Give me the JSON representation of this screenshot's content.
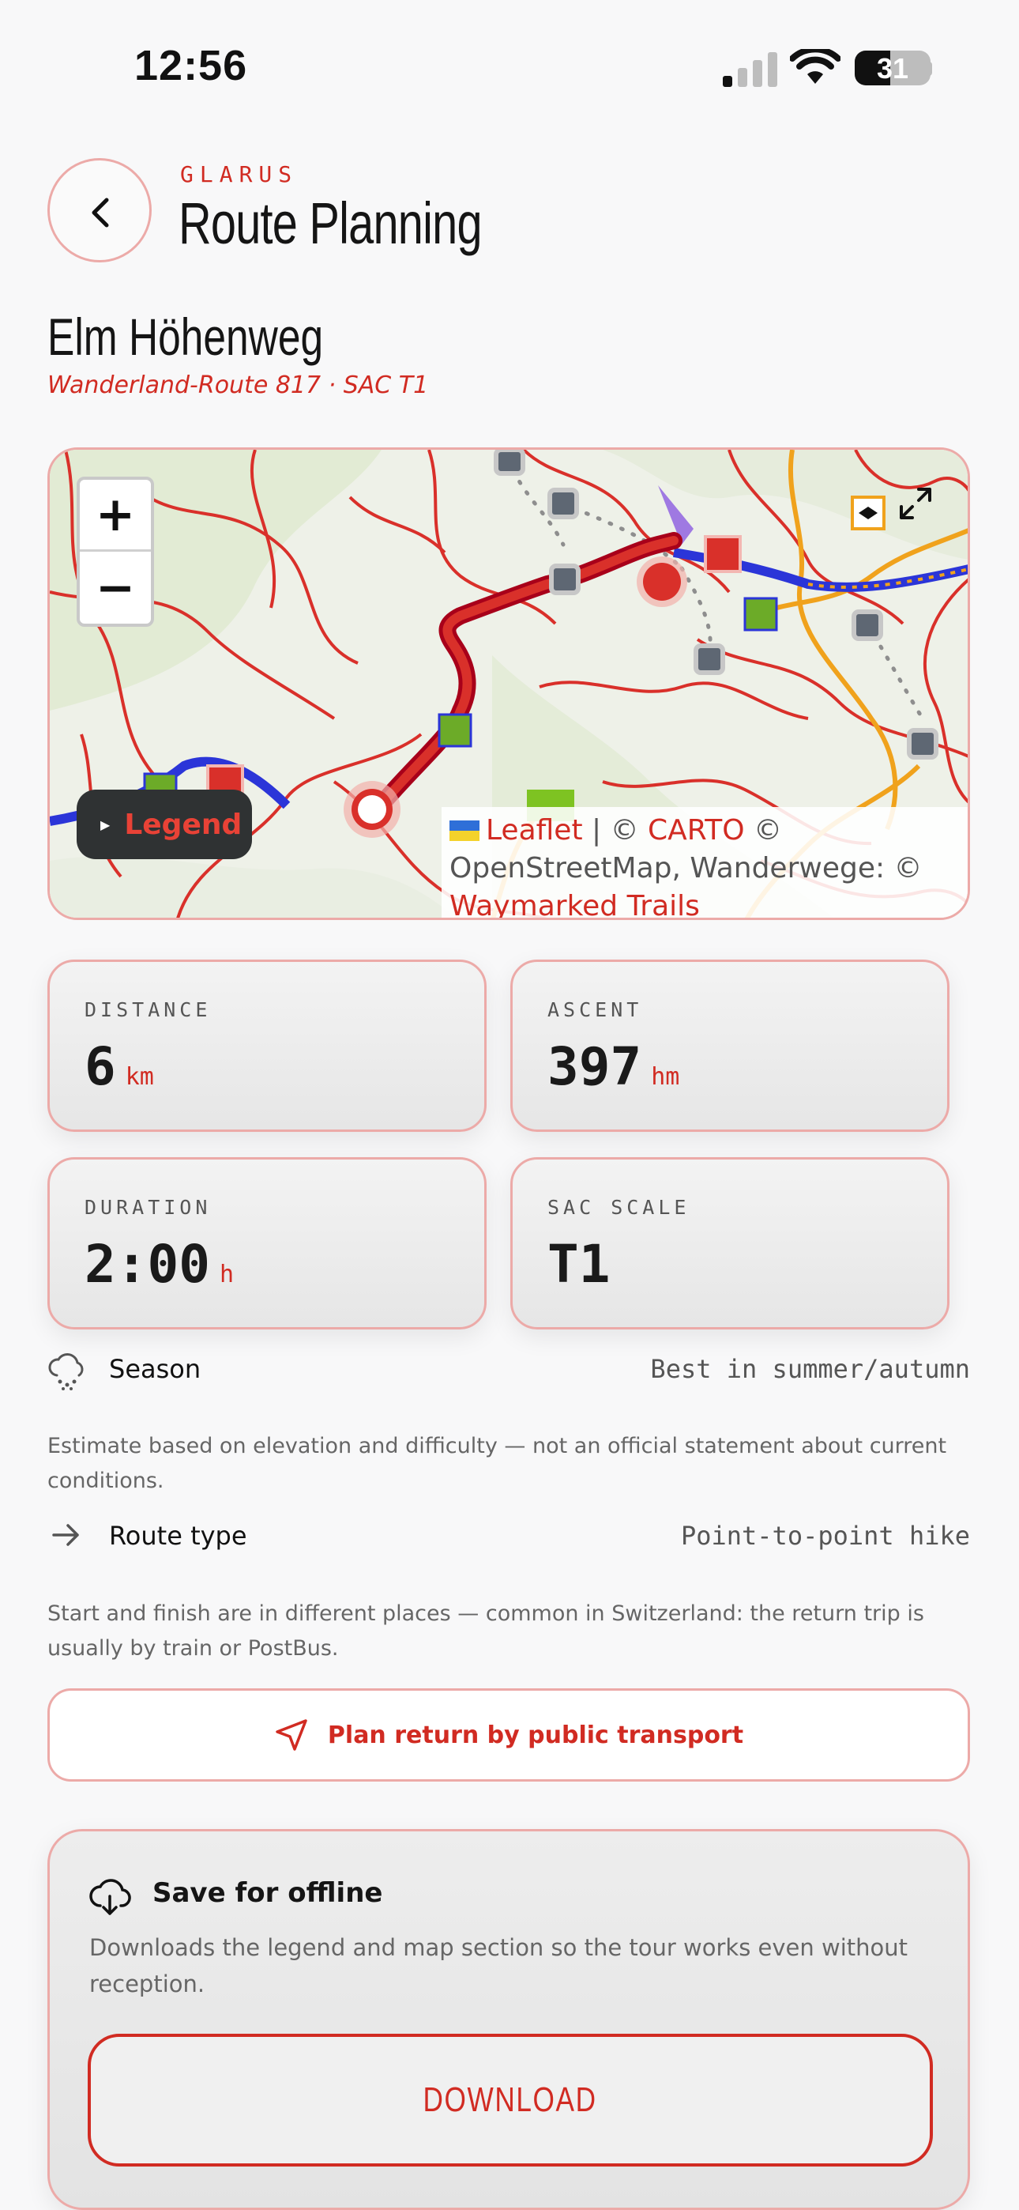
{
  "status_bar": {
    "time": "12:56",
    "battery": "31"
  },
  "header": {
    "region": "GLARUS",
    "title": "Route Planning"
  },
  "route": {
    "name": "Elm Höhenweg",
    "subtitle": "Wanderland-Route 817 · SAC T1"
  },
  "map": {
    "zoom_in": "+",
    "zoom_out": "−",
    "legend_label": "Legend",
    "attribution": {
      "leaflet": "Leaflet",
      "carto_prefix": " | © ",
      "carto": "CARTO",
      "osm": " © OpenStreetMap, Wanderwege: © ",
      "trails": "Waymarked Trails"
    }
  },
  "stats": [
    {
      "label": "DISTANCE",
      "value": "6",
      "unit": "km"
    },
    {
      "label": "ASCENT",
      "value": "397",
      "unit": "hm"
    },
    {
      "label": "DURATION",
      "value": "2:00",
      "unit": "h"
    },
    {
      "label": "SAC SCALE",
      "value": "T1",
      "unit": ""
    }
  ],
  "season": {
    "label": "Season",
    "value": "Best in summer/autumn",
    "note": "Estimate based on elevation and difficulty — not an official statement about current conditions."
  },
  "route_type": {
    "label": "Route type",
    "value": "Point-to-point hike",
    "note": "Start and finish are in different places — common in Switzerland: the return trip is usually by train or PostBus."
  },
  "public_transport_button": "Plan return by public transport",
  "offline": {
    "title": "Save for offline",
    "description": "Downloads the legend and map section so the tour works even without reception.",
    "button": "DOWNLOAD"
  },
  "colors": {
    "accent": "#d12b22",
    "border": "#ecaaa8"
  }
}
